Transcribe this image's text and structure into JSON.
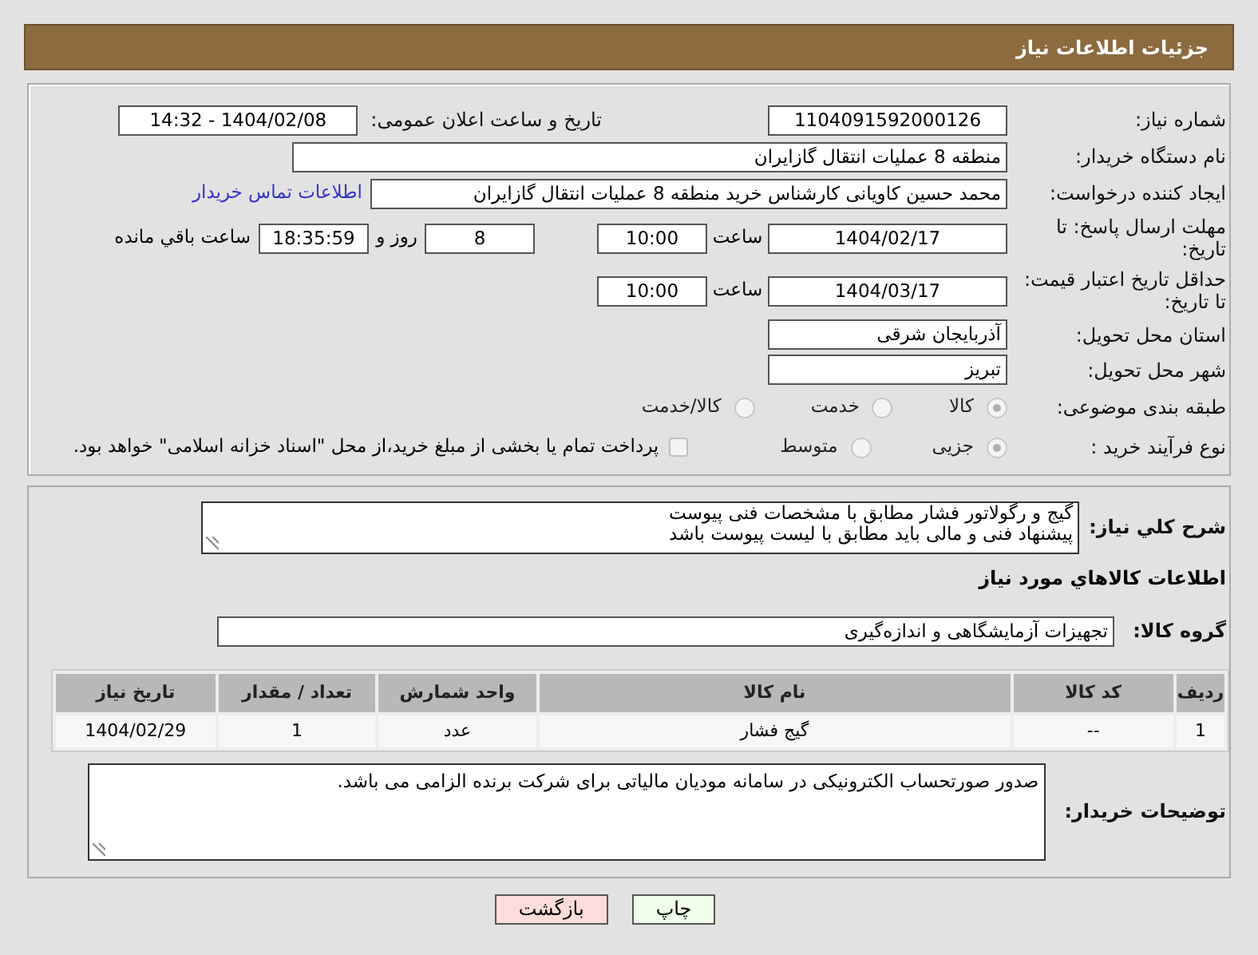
{
  "header": {
    "title": "جزئیات اطلاعات نیاز"
  },
  "need_number": {
    "label": "شماره نیاز:",
    "value": "1104091592000126"
  },
  "announce": {
    "label": "تاریخ و ساعت اعلان عمومی:",
    "value": "1404/02/08 - 14:32"
  },
  "buyer_org": {
    "label": "نام دستگاه خریدار:",
    "value": "منطقه 8 عملیات انتقال گازایران"
  },
  "requester": {
    "label": "ایجاد کننده درخواست:",
    "value": "محمد حسین کاویانی کارشناس خرید منطقه 8 عملیات انتقال گازایران",
    "link": "اطلاعات تماس خریدار"
  },
  "reply_deadline": {
    "label": "مهلت ارسال پاسخ: تا تاریخ:",
    "date": "1404/02/17",
    "time_label": "ساعت",
    "time": "10:00",
    "days": "8",
    "days_label": "روز و",
    "remaining": "18:35:59",
    "remaining_label": "ساعت باقي مانده"
  },
  "price_validity": {
    "label": "حداقل تاریخ اعتبار قیمت: تا تاریخ:",
    "date": "1404/03/17",
    "time_label": "ساعت",
    "time": "10:00"
  },
  "province": {
    "label": "استان محل تحویل:",
    "value": "آذربایجان شرقی"
  },
  "city": {
    "label": "شهر محل تحویل:",
    "value": "تبریز"
  },
  "category": {
    "label": "طبقه بندی موضوعی:",
    "options": [
      {
        "label": "کالا",
        "selected": true
      },
      {
        "label": "خدمت",
        "selected": false
      },
      {
        "label": "کالا/خدمت",
        "selected": false
      }
    ]
  },
  "purchase_type": {
    "label": "نوع فرآیند خرید :",
    "options": [
      {
        "label": "جزیی",
        "selected": true
      },
      {
        "label": "متوسط",
        "selected": false
      }
    ],
    "payment_note": {
      "label": "پرداخت تمام یا بخشی از مبلغ خرید،از محل \"اسناد خزانه اسلامی\" خواهد بود.",
      "checked": false
    }
  },
  "description": {
    "label": "شرح کلي نیاز:",
    "value": "گیج و رگولاتور فشار مطابق با مشخصات فنی پیوست\nپیشنهاد فنی و مالی باید مطابق با لیست پیوست باشد"
  },
  "goods_heading": "اطلاعات کالاهاي مورد نیاز",
  "goods_group": {
    "label": "گروه کالا:",
    "value": "تجهیزات آزمایشگاهی و اندازه‌گیری"
  },
  "table": {
    "columns": [
      "ردیف",
      "کد کالا",
      "نام کالا",
      "واحد شمارش",
      "تعداد / مقدار",
      "تاریخ نیاز"
    ],
    "rows": [
      [
        "1",
        "--",
        "گیج فشار",
        "عدد",
        "1",
        "1404/02/29"
      ]
    ]
  },
  "buyer_notes": {
    "label": "توضیحات خریدار:",
    "value": "صدور صورتحساب الکترونیکی در سامانه مودیان مالیاتی برای شرکت برنده الزامی می باشد."
  },
  "buttons": [
    {
      "label": "چاپ",
      "kind": "print"
    },
    {
      "label": "بازگشت",
      "kind": "back"
    }
  ]
}
